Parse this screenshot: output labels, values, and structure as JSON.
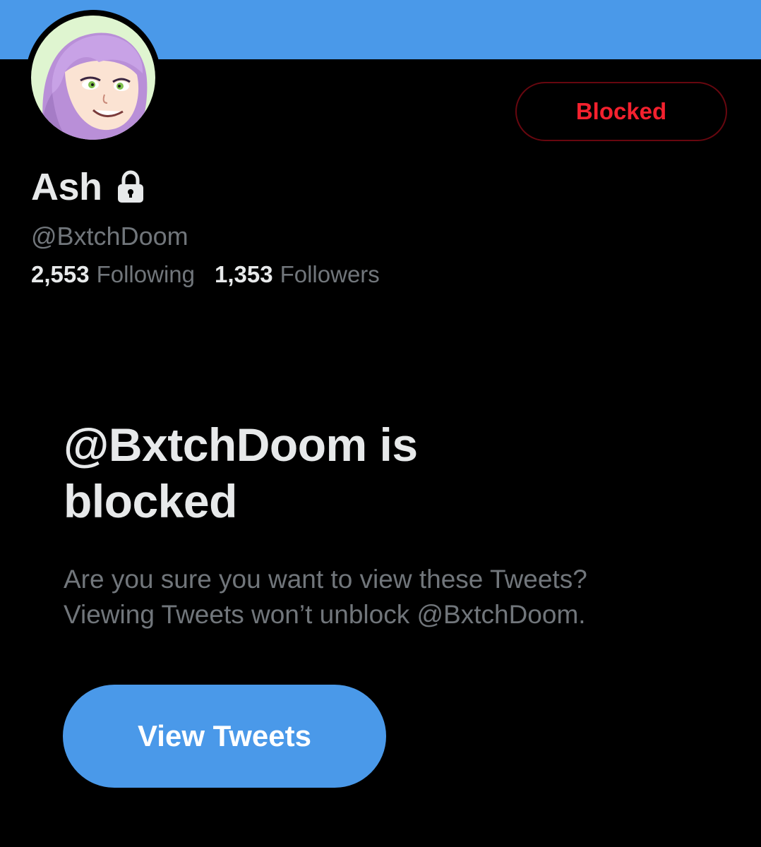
{
  "colors": {
    "banner": "#4a99e9",
    "accent": "#4a99e9",
    "blocked_text": "#f4212e",
    "blocked_border": "#67070f",
    "primary_text": "#e7e9ea",
    "secondary_text": "#71767b",
    "background": "#000000"
  },
  "profile": {
    "display_name": "Ash",
    "verified_icon": "lock-icon",
    "handle": "@BxtchDoom",
    "following_count": "2,553",
    "following_label": "Following",
    "followers_count": "1,353",
    "followers_label": "Followers"
  },
  "header": {
    "blocked_button_label": "Blocked"
  },
  "blocked_notice": {
    "title": "@BxtchDoom is blocked",
    "description_line1": "Are you sure you want to view these Tweets?",
    "description_line2": "Viewing Tweets won’t unblock @BxtchDoom.",
    "view_button_label": "View Tweets"
  }
}
